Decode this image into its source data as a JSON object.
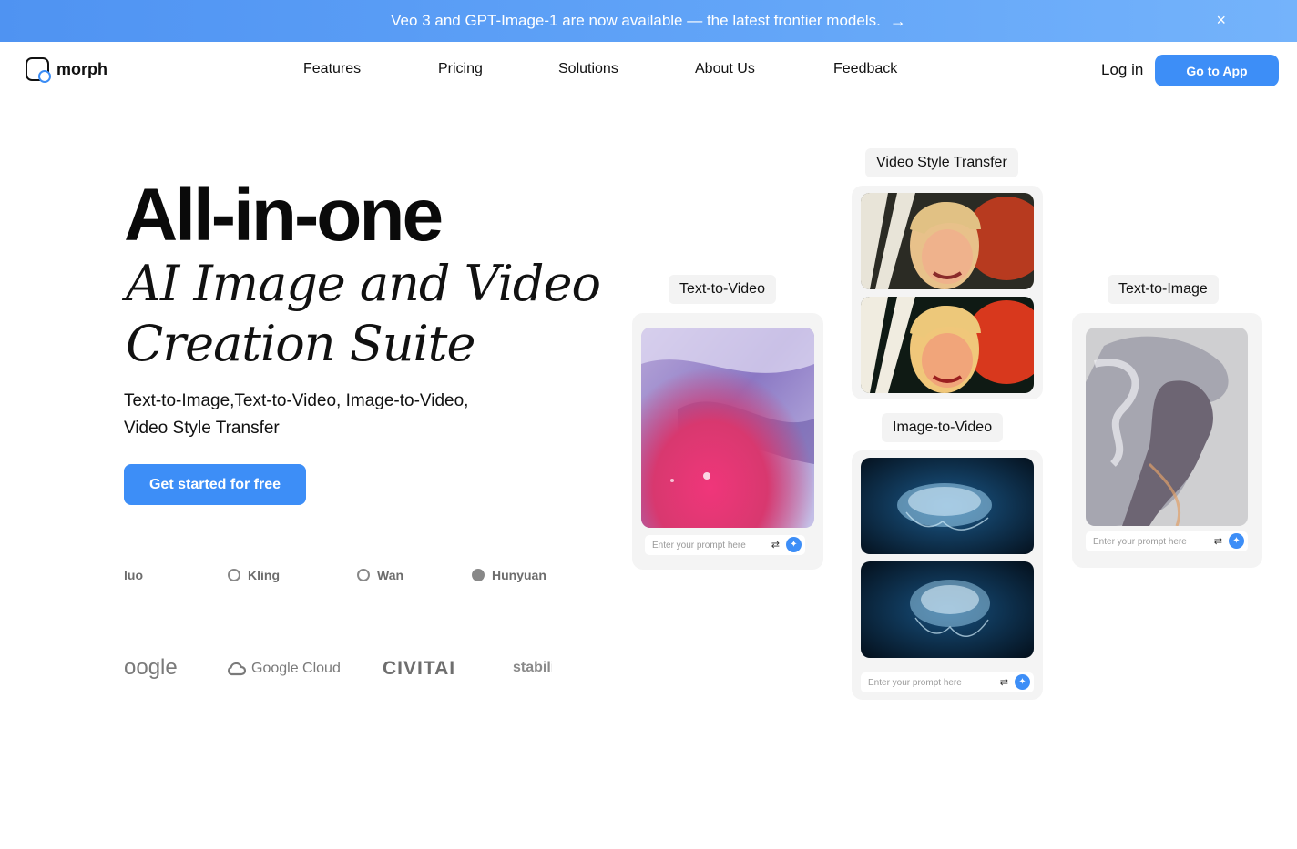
{
  "banner": {
    "text": "Veo 3 and GPT-Image-1 are now available — the latest frontier models.",
    "arrow": "→",
    "close": "×"
  },
  "header": {
    "logo_text": "morph",
    "nav": [
      "Features",
      "Pricing",
      "Solutions",
      "About Us",
      "Feedback"
    ],
    "login": "Log in",
    "go_to_app": "Go to App"
  },
  "hero": {
    "title_bold": "All-in-one",
    "title_script_1": "AI Image and Video",
    "title_script_2": "Creation Suite",
    "subtitle_1": "Text-to-Image,Text-to-Video, Image-to-Video,",
    "subtitle_2": "Video Style Transfer",
    "cta": "Get started for free"
  },
  "brands_row1": [
    "luo",
    "Kling",
    "Wan",
    "Hunyuan"
  ],
  "brands_row2": [
    "oogle",
    "Google Cloud",
    "CIVITAI",
    "stabili"
  ],
  "showcase": {
    "text_to_video": {
      "label": "Text-to-Video",
      "placeholder": "Enter your prompt here"
    },
    "video_style_transfer": {
      "label": "Video Style Transfer"
    },
    "image_to_video": {
      "label": "Image-to-Video",
      "placeholder": "Enter your prompt here"
    },
    "text_to_image": {
      "label": "Text-to-Image",
      "placeholder": "Enter your prompt here"
    }
  },
  "colors": {
    "accent": "#3d8ef7",
    "banner_start": "#4f93f2",
    "banner_end": "#74b3fb"
  }
}
